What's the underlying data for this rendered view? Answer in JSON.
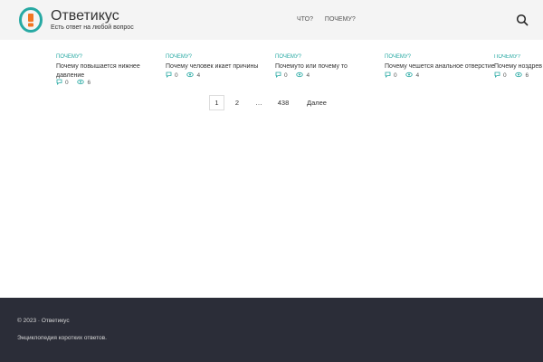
{
  "site": {
    "title": "Ответикус",
    "description": "Есть ответ на любой вопрос"
  },
  "nav": {
    "items": [
      "ЧТО?",
      "ПОЧЕМУ?"
    ]
  },
  "colors": {
    "accent": "#27a9a3",
    "logo_ring": "#27a9a3",
    "logo_mark": "#f27521",
    "header_bg": "#f4f4f4",
    "footer_bg": "#2b2d38"
  },
  "cards": [
    {
      "category": "ПОЧЕМУ?",
      "title_lines": [
        "Почему повышается нижнее",
        "давление"
      ],
      "comments": "0",
      "views": "6"
    },
    {
      "category": "ПОЧЕМУ?",
      "title_lines": [
        "Почему человек икает причины"
      ],
      "comments": "0",
      "views": "4"
    },
    {
      "category": "ПОЧЕМУ?",
      "title_lines": [
        "Почемуто или почему то"
      ],
      "comments": "0",
      "views": "4"
    },
    {
      "category": "ПОЧЕМУ?",
      "title_lines": [
        "Почему чешется анальное отверстие"
      ],
      "comments": "0",
      "views": "4"
    },
    {
      "category": "ПОЧЕМУ?",
      "title_lines": [
        "Почему ноздрев"
      ],
      "comments": "0",
      "views": "6"
    }
  ],
  "pagination": {
    "current": "1",
    "next_page": "2",
    "ellipsis": "…",
    "last": "438",
    "next_label": "Далее"
  },
  "footer": {
    "copyright": "© 2023 · Ответикус",
    "text": "Энциклопедия коротких ответов."
  }
}
